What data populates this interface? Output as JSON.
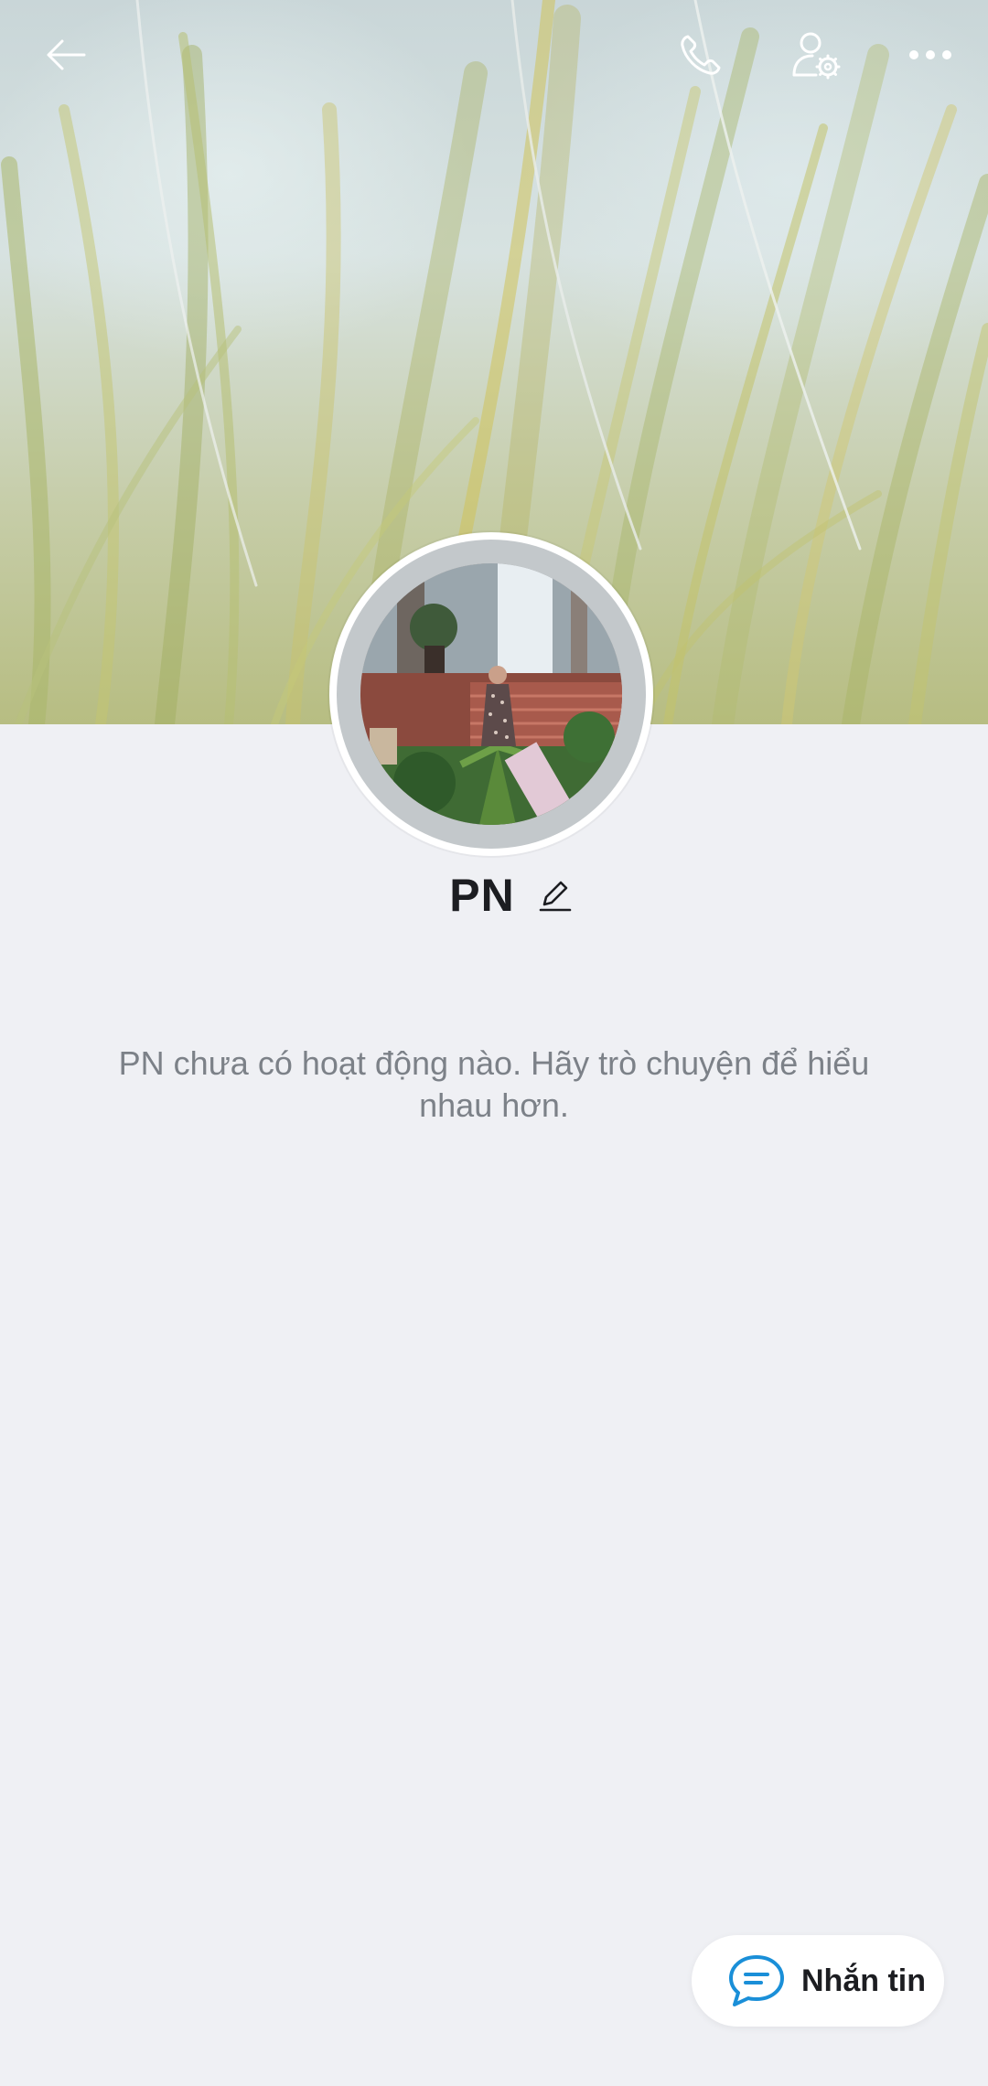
{
  "profile": {
    "name": "PN",
    "empty_activity_message": "PN chưa có hoạt động nào. Hãy trò chuyện để hiểu nhau hơn."
  },
  "actions": {
    "message_label": "Nhắn tin"
  },
  "icons": {
    "back": "arrow-left",
    "call": "phone",
    "profile_settings": "user-gear",
    "more": "more-horizontal",
    "edit": "pencil",
    "message": "chat-bubble"
  },
  "colors": {
    "background": "#eff0f4",
    "name_text": "#1c1d21",
    "secondary_text": "#7c8188",
    "accent": "#1a8fd8"
  }
}
